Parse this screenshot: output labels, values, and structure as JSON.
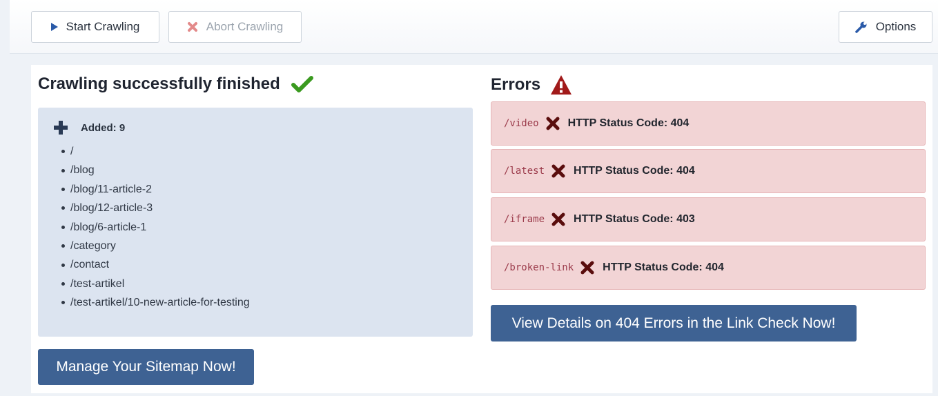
{
  "toolbar": {
    "start_label": "Start Crawling",
    "start_icon": "play-icon",
    "abort_label": "Abort Crawling",
    "abort_icon": "x-icon",
    "options_label": "Options",
    "options_icon": "wrench-icon"
  },
  "left": {
    "title": "Crawling successfully finished",
    "title_icon": "checkmark-icon",
    "added_label": "Added: 9",
    "added_icon": "plus-icon",
    "urls": [
      "/",
      "/blog",
      "/blog/11-article-2",
      "/blog/12-article-3",
      "/blog/6-article-1",
      "/category",
      "/contact",
      "/test-artikel",
      "/test-artikel/10-new-article-for-testing"
    ],
    "manage_button": "Manage Your Sitemap Now!"
  },
  "right": {
    "title": "Errors",
    "title_icon": "warning-icon",
    "errors": [
      {
        "path": "/video",
        "status": "HTTP Status Code: 404"
      },
      {
        "path": "/latest",
        "status": "HTTP Status Code: 404"
      },
      {
        "path": "/iframe",
        "status": "HTTP Status Code: 403"
      },
      {
        "path": "/broken-link",
        "status": "HTTP Status Code: 404"
      }
    ],
    "details_button": "View Details on 404 Errors in the Link Check Now!"
  },
  "colors": {
    "primary_button": "#3e6293",
    "error_bg": "#f2d4d5",
    "success_check": "#3a9a1f",
    "warning": "#a11a1a",
    "added_bg": "#dce4f0"
  }
}
